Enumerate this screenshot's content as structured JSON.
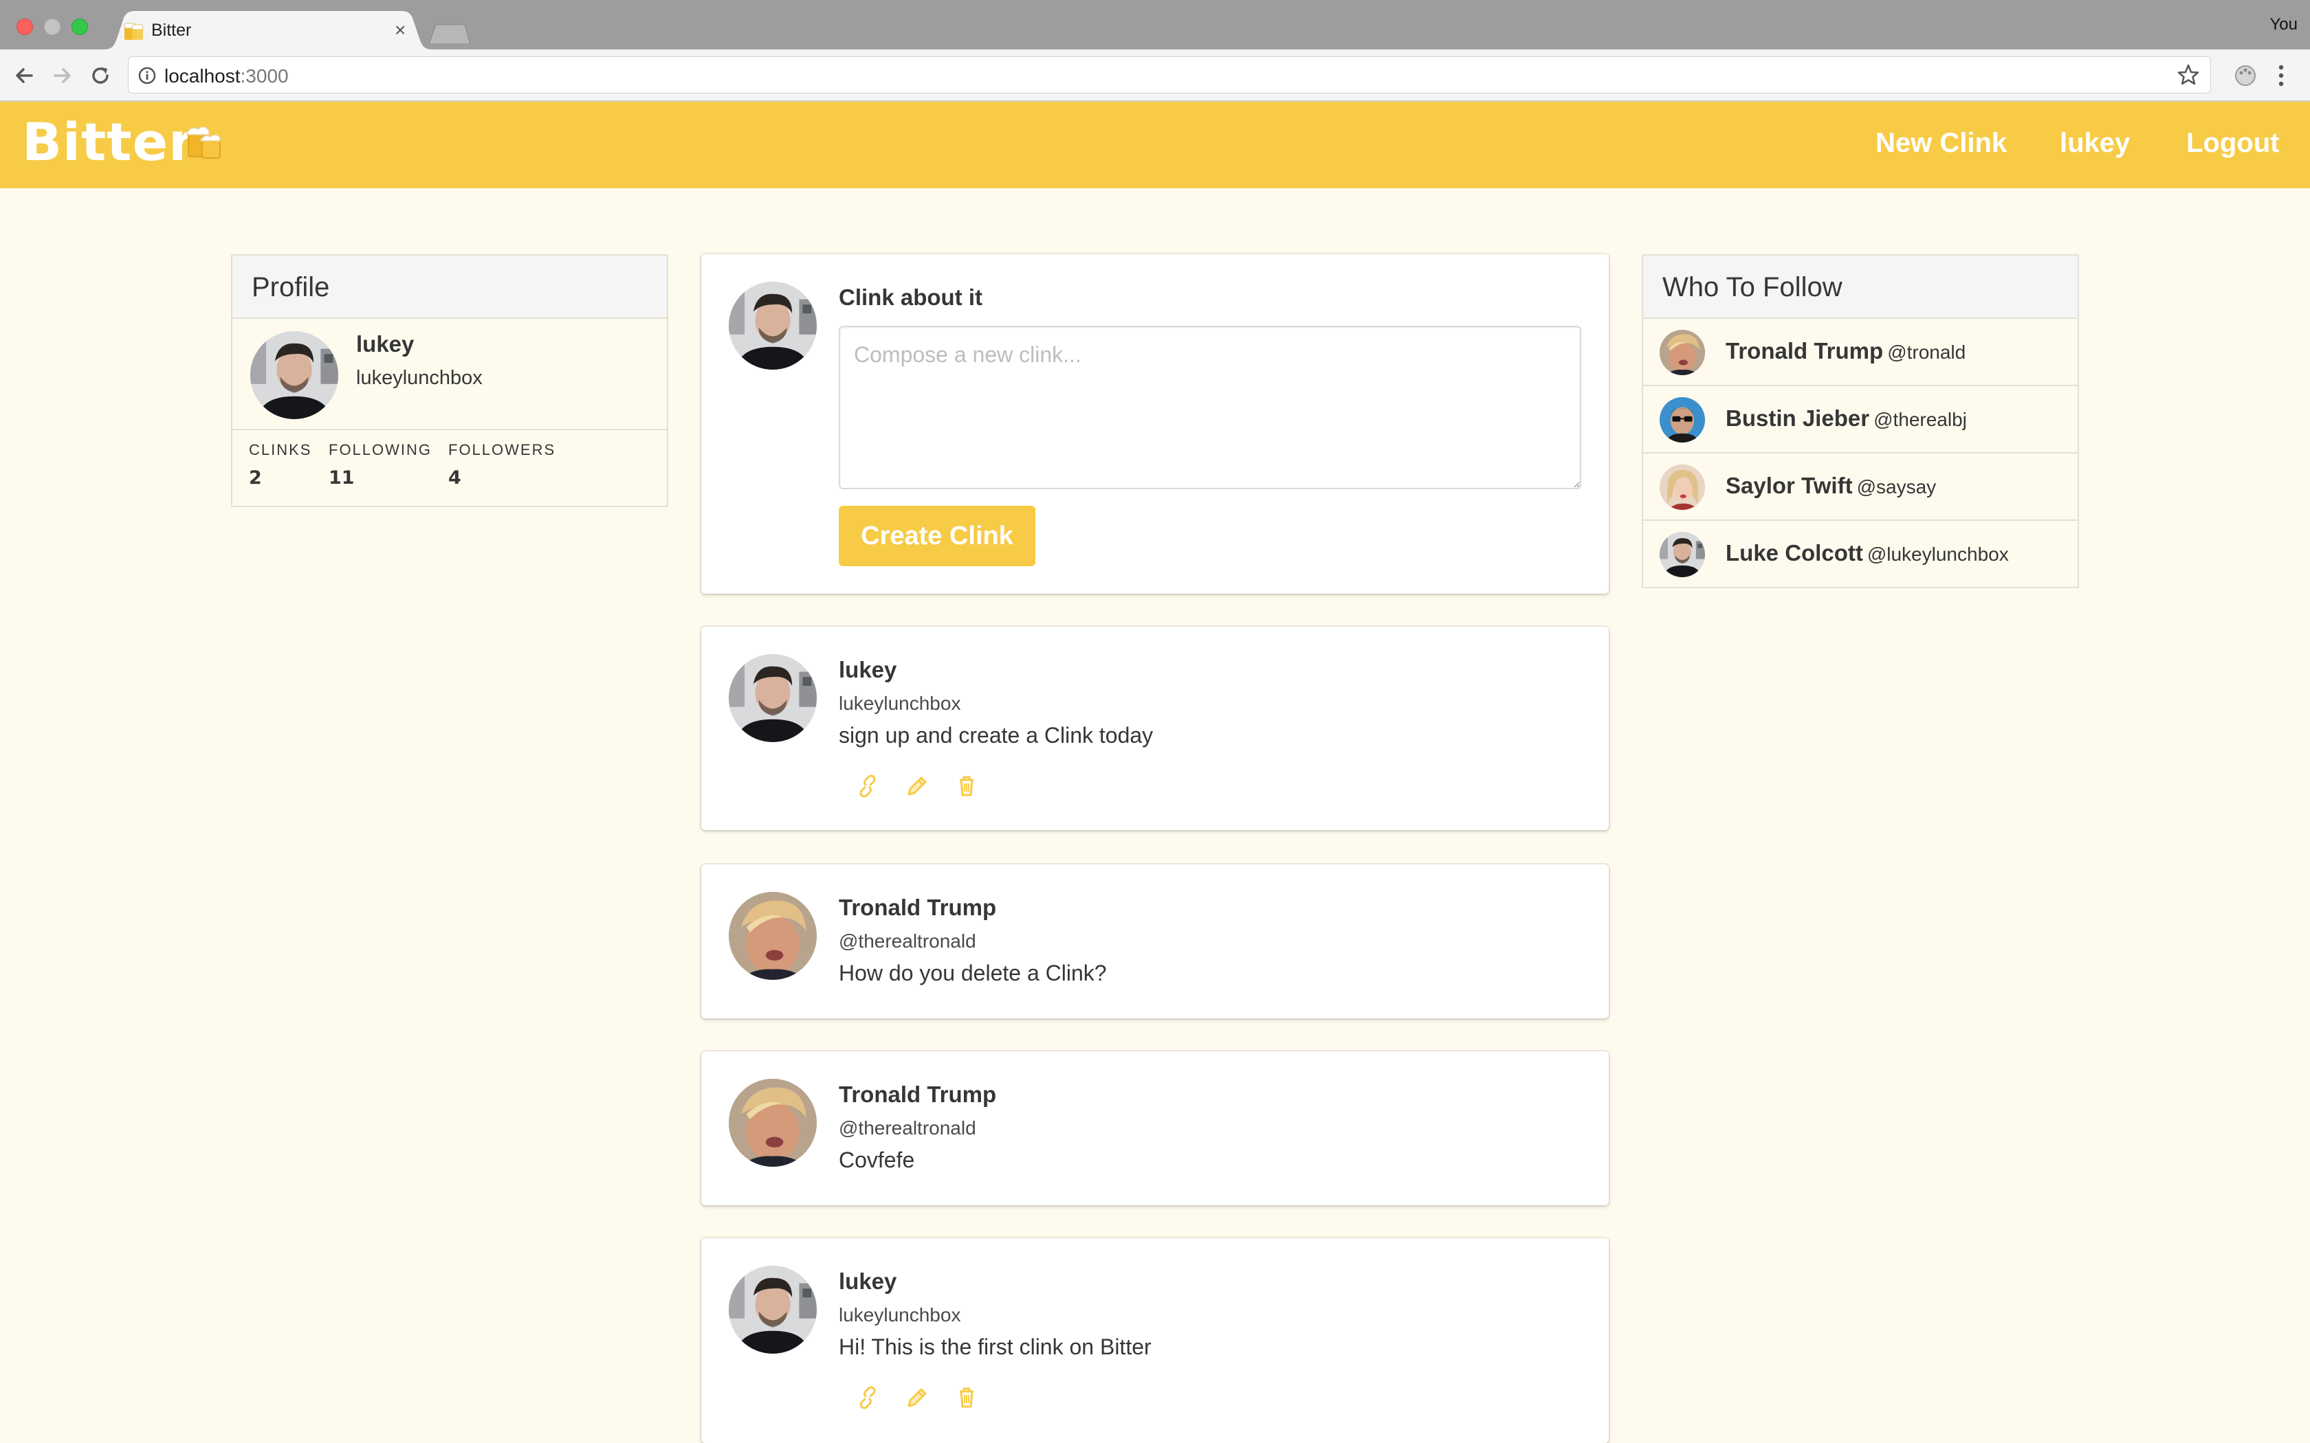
{
  "browser": {
    "tab_title": "Bitter",
    "profile_name": "You",
    "url_host": "localhost",
    "url_port": ":3000"
  },
  "navbar": {
    "brand": "Bitter",
    "links": [
      "New Clink",
      "lukey",
      "Logout"
    ],
    "accent_color": "#f7cb46"
  },
  "profile": {
    "heading": "Profile",
    "name": "lukey",
    "handle": "lukeylunchbox",
    "stats": [
      {
        "label": "CLINKS",
        "value": "2"
      },
      {
        "label": "FOLLOWING",
        "value": "11"
      },
      {
        "label": "FOLLOWERS",
        "value": "4"
      }
    ]
  },
  "compose": {
    "label": "Clink about it",
    "placeholder": "Compose a new clink...",
    "button_label": "Create Clink"
  },
  "feed": [
    {
      "name": "lukey",
      "handle": "lukeylunchbox",
      "text": "sign up and create a Clink today",
      "avatar": "lukey",
      "own": true
    },
    {
      "name": "Tronald Trump",
      "handle": "@therealtronald",
      "text": "How do you delete a Clink?",
      "avatar": "trump",
      "own": false
    },
    {
      "name": "Tronald Trump",
      "handle": "@therealtronald",
      "text": "Covfefe",
      "avatar": "trump",
      "own": false
    },
    {
      "name": "lukey",
      "handle": "lukeylunchbox",
      "text": "Hi! This is the first clink on Bitter",
      "avatar": "lukey",
      "own": true
    }
  ],
  "post_action_icons": [
    "link-icon",
    "pencil-icon",
    "trash-icon"
  ],
  "who_to_follow": {
    "heading": "Who To Follow",
    "users": [
      {
        "name": "Tronald Trump",
        "handle": "@tronald",
        "avatar": "trump"
      },
      {
        "name": "Bustin Jieber",
        "handle": "@therealbj",
        "avatar": "jieber"
      },
      {
        "name": "Saylor Twift",
        "handle": "@saysay",
        "avatar": "twift"
      },
      {
        "name": "Luke Colcott",
        "handle": "@lukeylunchbox",
        "avatar": "lukey"
      }
    ]
  }
}
